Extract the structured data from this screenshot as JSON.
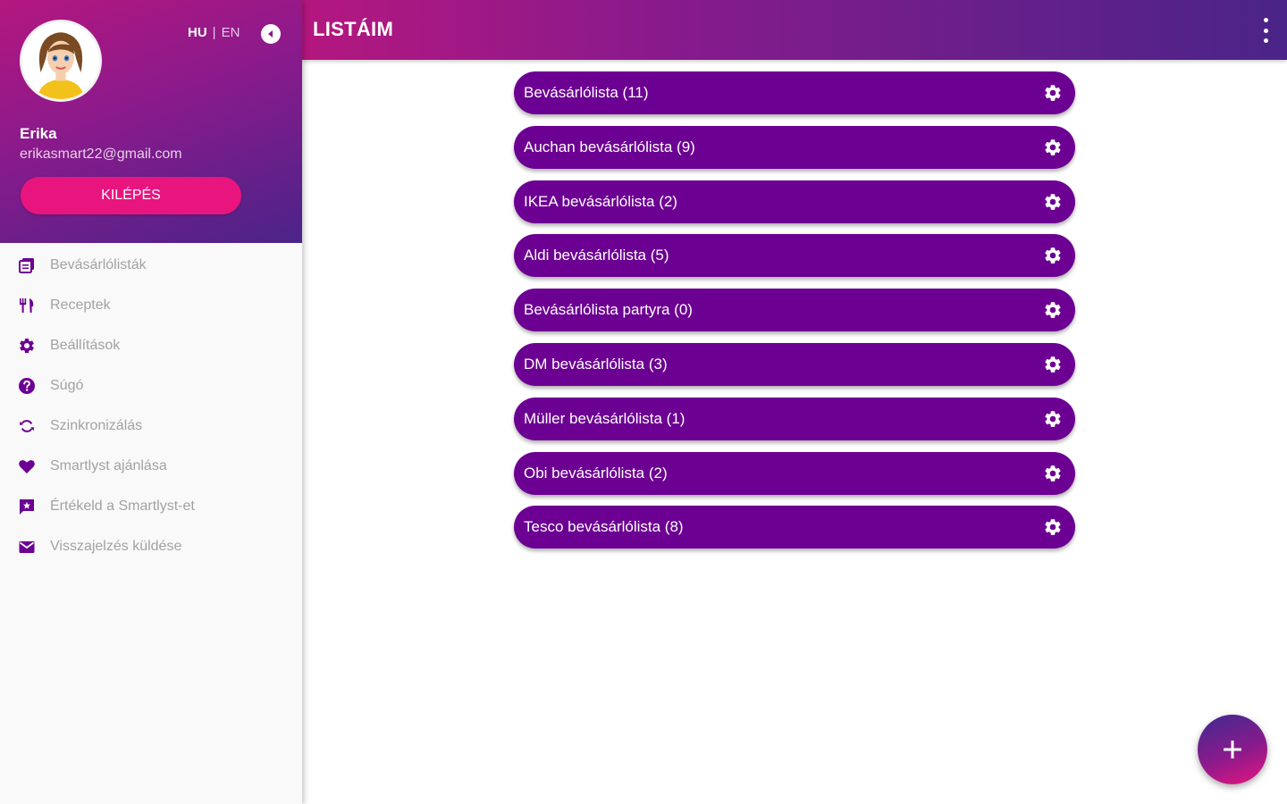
{
  "sidebar": {
    "lang": {
      "hu": "HU",
      "separator": "|",
      "en": "EN"
    },
    "user": {
      "name": "Erika",
      "email": "erikasmart22@gmail.com"
    },
    "logout_label": "KILÉPÉS",
    "items": [
      {
        "label": "Bevásárlólisták",
        "icon": "shopping-list-icon"
      },
      {
        "label": "Receptek",
        "icon": "fork-knife-icon"
      },
      {
        "label": "Beállítások",
        "icon": "gear-icon"
      },
      {
        "label": "Súgó",
        "icon": "help-icon"
      },
      {
        "label": "Szinkronizálás",
        "icon": "sync-icon"
      },
      {
        "label": "Smartlyst ajánlása",
        "icon": "heart-icon"
      },
      {
        "label": "Értékeld a Smartlyst-et",
        "icon": "rate-icon"
      },
      {
        "label": "Visszajelzés küldése",
        "icon": "mail-icon"
      }
    ]
  },
  "header": {
    "title": "LISTÁIM"
  },
  "lists": [
    {
      "label": "Bevásárlólista (11)"
    },
    {
      "label": "Auchan bevásárlólista (9)"
    },
    {
      "label": "IKEA bevásárlólista (2)"
    },
    {
      "label": "Aldi bevásárlólista (5)"
    },
    {
      "label": "Bevásárlólista partyra (0)"
    },
    {
      "label": "DM bevásárlólista (3)"
    },
    {
      "label": "Müller bevásárlólista (1)"
    },
    {
      "label": "Obi bevásárlólista (2)"
    },
    {
      "label": "Tesco bevásárlólista (8)"
    }
  ],
  "colors": {
    "primary": "#6c0092",
    "accent": "#e8157f",
    "header_start": "#b4177f",
    "header_end": "#4a2488",
    "menu_text": "#a2a2a2",
    "menu_icon": "#6c0092"
  }
}
